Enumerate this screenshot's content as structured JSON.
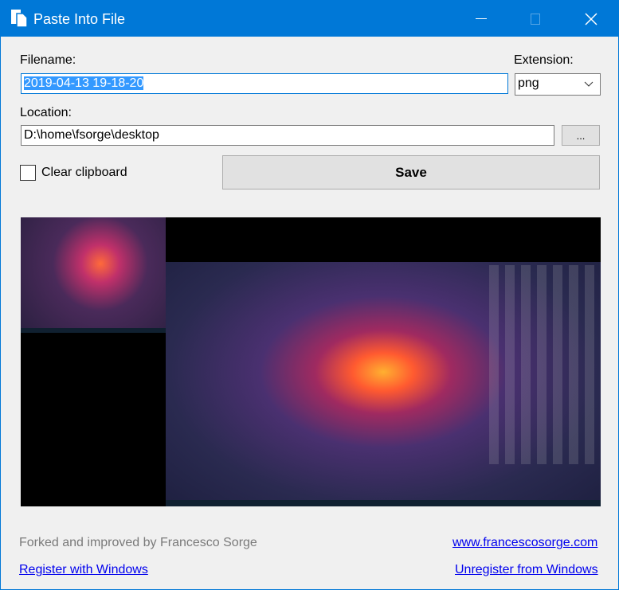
{
  "window": {
    "title": "Paste Into File"
  },
  "form": {
    "filename_label": "Filename:",
    "filename_value": "2019-04-13 19-18-20",
    "extension_label": "Extension:",
    "extension_value": "png",
    "location_label": "Location:",
    "location_value": "D:\\home\\fsorge\\desktop",
    "browse_label": "...",
    "clear_clipboard_label": "Clear clipboard",
    "clear_clipboard_checked": false,
    "save_label": "Save"
  },
  "footer": {
    "credit": "Forked and improved by Francesco Sorge",
    "website": "www.francescosorge.com",
    "register": "Register with Windows",
    "unregister": "Unregister from Windows"
  },
  "colors": {
    "accent": "#0078d7",
    "selection": "#3399ff",
    "link": "#0000ee"
  }
}
